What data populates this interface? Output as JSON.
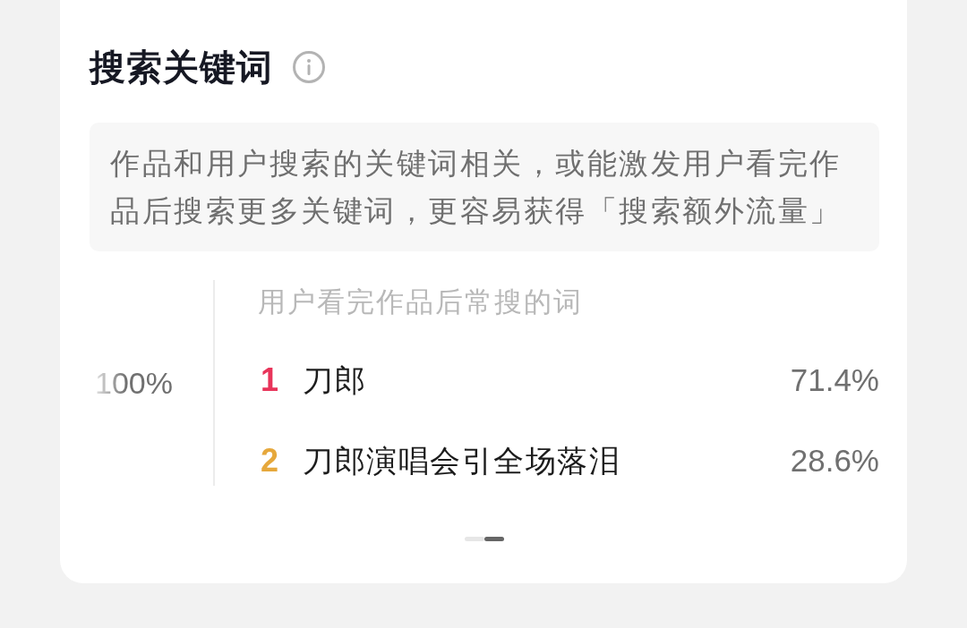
{
  "card": {
    "title": "搜索关键词",
    "description": "作品和用户搜索的关键词相关，或能激发用户看完作品后搜索更多关键词，更容易获得「搜索额外流量」",
    "previous_panel": {
      "value": "100%"
    },
    "keywords_panel": {
      "heading": "用户看完作品后常搜的词",
      "rows": [
        {
          "rank": "1",
          "color": "#e8345a",
          "keyword": "刀郎",
          "share": "71.4%"
        },
        {
          "rank": "2",
          "color": "#e6a83c",
          "keyword": "刀郎演唱会引全场落泪",
          "share": "28.6%"
        }
      ]
    },
    "pagination": [
      {
        "selected": false
      },
      {
        "selected": true
      }
    ]
  }
}
